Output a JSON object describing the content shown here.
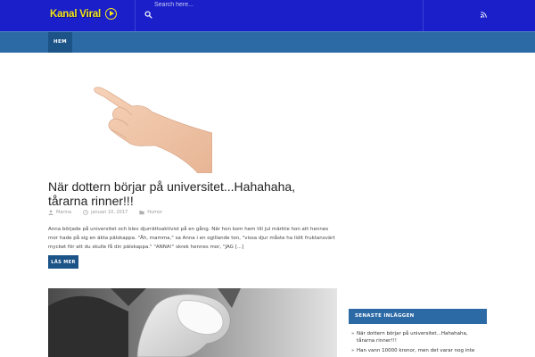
{
  "header": {
    "logo_text": "Kanal Viral",
    "search_placeholder": "Search here...",
    "brand_color": "#1a1fc9",
    "logo_color": "#f6e71a"
  },
  "nav": {
    "items": [
      {
        "label": "Hem"
      }
    ],
    "color": "#2c6aa6"
  },
  "posts": [
    {
      "title": "När dottern börjar på universitet...Hahahaha, tårarna rinner!!!",
      "author": "Marina",
      "date": "januari 10, 2017",
      "category": "Humor",
      "excerpt": "Anna började på universitet och blev djurrättsaktivist på en gång. När hon kom hem till jul märkte hon att hennes mor hade på sig en äkta pälskappa. \"Åh, mamma,\" sa Anna i en ogillande ton, \"vissa djur måste ha lidit fruktansvärt mycket för att du skulle få din pälskappa.\" \"ANNA!\" skrek hennes mor, \"JAG [...]",
      "read_more": "Läs mer"
    }
  ],
  "sidebar": {
    "widget_title": "Senaste inläggen",
    "recent_posts": [
      "När dottern börjar på universitet...Hahahaha, tårarna rinner!!!",
      "Han vann 10000 kronor, men det varar nog inte"
    ]
  }
}
